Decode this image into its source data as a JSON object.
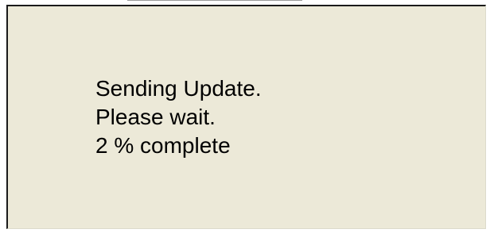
{
  "dialog": {
    "message_lines": [
      "Sending Update.",
      "Please wait."
    ],
    "progress": {
      "percent": 2,
      "label": "2 % complete"
    },
    "background_color": "#ece9d8",
    "text_color": "#000000"
  }
}
